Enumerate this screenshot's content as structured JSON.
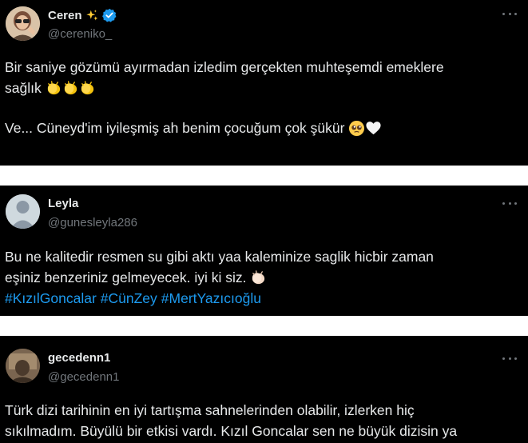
{
  "tweets": [
    {
      "display_name": "Ceren",
      "name_emoji": "sparkles-icon",
      "verified": true,
      "handle": "@cereniko_",
      "lines": [
        "Bir saniye gözümü ayırmadan izledim gerçekten muhteşemdi emeklere",
        "sağlık",
        "Ve... Cüneyd'im iyileşmiş ah benim çocuğum çok şükür"
      ]
    },
    {
      "display_name": "Leyla",
      "handle": "@gunesleyla286",
      "lines": [
        "Bu ne kalitedir resmen su gibi aktı yaa kaleminize saglik hicbir zaman",
        "eşiniz benzeriniz gelmeyecek. iyi ki siz."
      ],
      "hashtags": [
        "#KızılGoncalar",
        "#CünZey",
        "#MertYazıcıoğlu"
      ]
    },
    {
      "display_name": "gecedenn1",
      "handle": "@gecedenn1",
      "lines": [
        "Türk dizi tarihinin en iyi tartışma sahnelerinden olabilir, izlerken hiç",
        "sıkılmadım. Büyülü bir etkisi vardı. Kızıl Goncalar sen ne büyük dizisin ya"
      ]
    }
  ],
  "colors": {
    "background": "#000000",
    "text": "#e7e9ea",
    "muted": "#71767b",
    "link": "#1d9bf0",
    "verified": "#1d9bf0"
  },
  "icons": {
    "more": "more-horizontal-icon",
    "verified": "verified-badge-icon",
    "clap": "clapping-hands-icon",
    "pleading": "pleading-face-icon",
    "heart": "white-heart-icon"
  }
}
